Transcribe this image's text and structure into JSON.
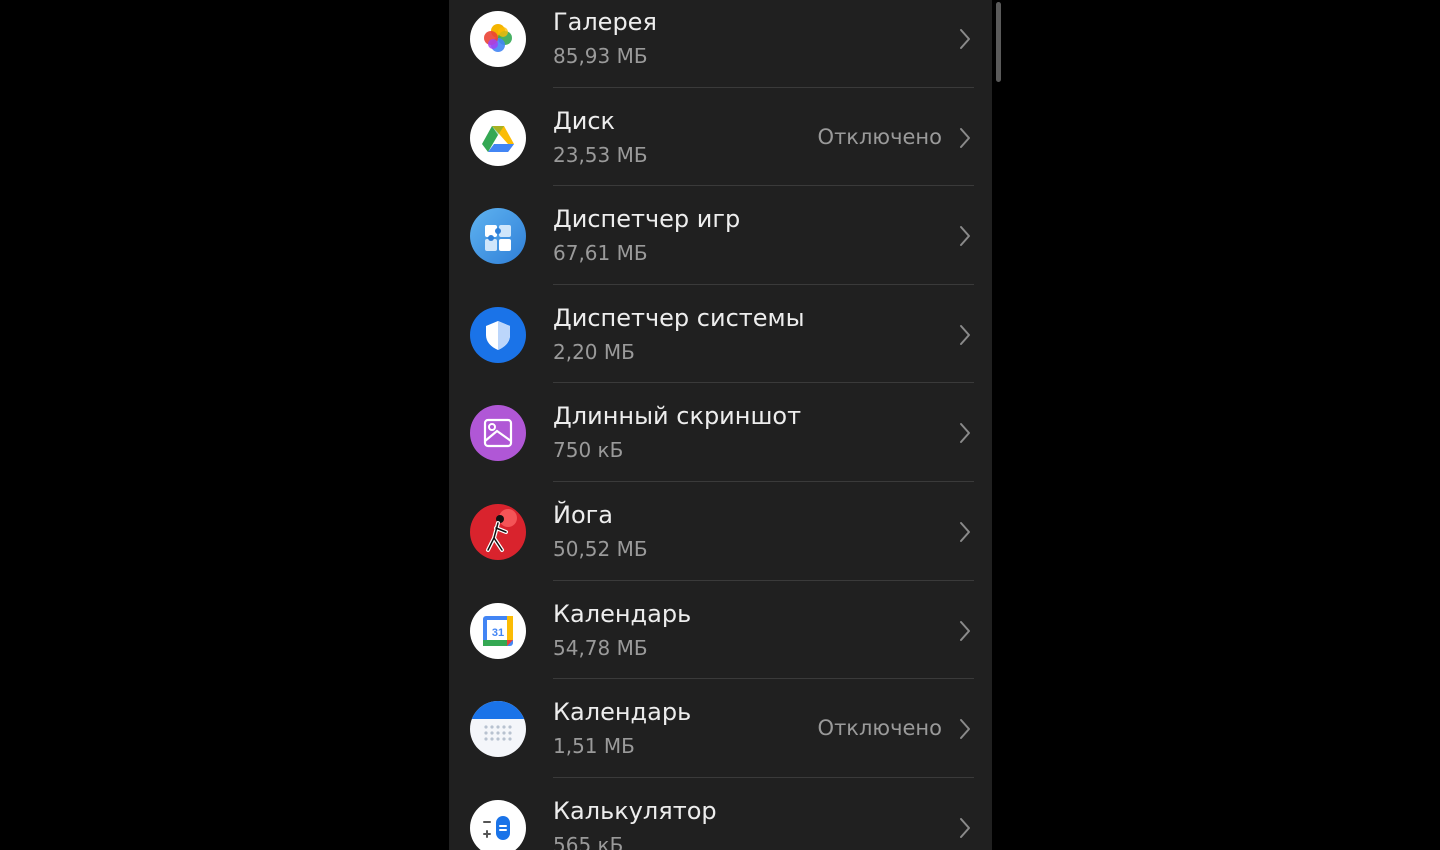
{
  "apps": [
    {
      "name": "Галерея",
      "size": "85,93 МБ",
      "status": "",
      "icon": "gallery-icon"
    },
    {
      "name": "Диск",
      "size": "23,53 МБ",
      "status": "Отключено",
      "icon": "drive-icon"
    },
    {
      "name": "Диспетчер игр",
      "size": "67,61 МБ",
      "status": "",
      "icon": "game-manager-icon"
    },
    {
      "name": "Диспетчер системы",
      "size": "2,20 МБ",
      "status": "",
      "icon": "system-manager-icon"
    },
    {
      "name": "Длинный скриншот",
      "size": "750 кБ",
      "status": "",
      "icon": "long-screenshot-icon"
    },
    {
      "name": "Йога",
      "size": "50,52 МБ",
      "status": "",
      "icon": "yoga-icon"
    },
    {
      "name": "Календарь",
      "size": "54,78 МБ",
      "status": "",
      "icon": "google-calendar-icon"
    },
    {
      "name": "Календарь",
      "size": "1,51 МБ",
      "status": "Отключено",
      "icon": "calendar-icon"
    },
    {
      "name": "Калькулятор",
      "size": "565 кБ",
      "status": "",
      "icon": "calculator-icon"
    }
  ],
  "icon_text": {
    "calendar_day": "31"
  },
  "colors": {
    "background": "#000000",
    "panel": "#202020",
    "primary_text": "#ededed",
    "secondary_text": "#9a9a9a",
    "divider": "#3a3a3a"
  }
}
